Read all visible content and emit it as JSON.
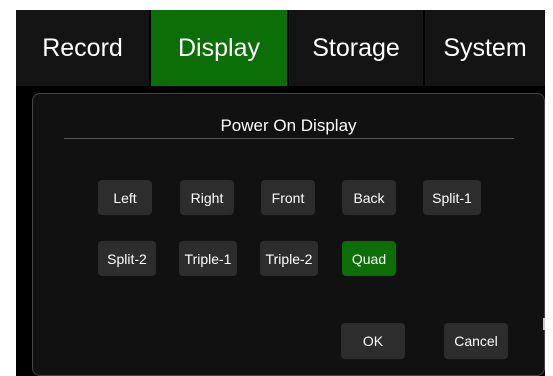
{
  "tabs": [
    {
      "label": "Record"
    },
    {
      "label": "Display",
      "active": true
    },
    {
      "label": "Storage"
    },
    {
      "label": "System"
    }
  ],
  "dialog": {
    "title": "Power On Display",
    "options": [
      {
        "label": "Left"
      },
      {
        "label": "Right"
      },
      {
        "label": "Front"
      },
      {
        "label": "Back"
      },
      {
        "label": "Split-1"
      },
      {
        "label": "Split-2"
      },
      {
        "label": "Triple-1"
      },
      {
        "label": "Triple-2"
      },
      {
        "label": "Quad",
        "selected": true
      }
    ],
    "ok_label": "OK",
    "cancel_label": "Cancel"
  },
  "colors": {
    "accent": "#0b6e06",
    "background": "#000000",
    "button": "#2d2d2d"
  }
}
